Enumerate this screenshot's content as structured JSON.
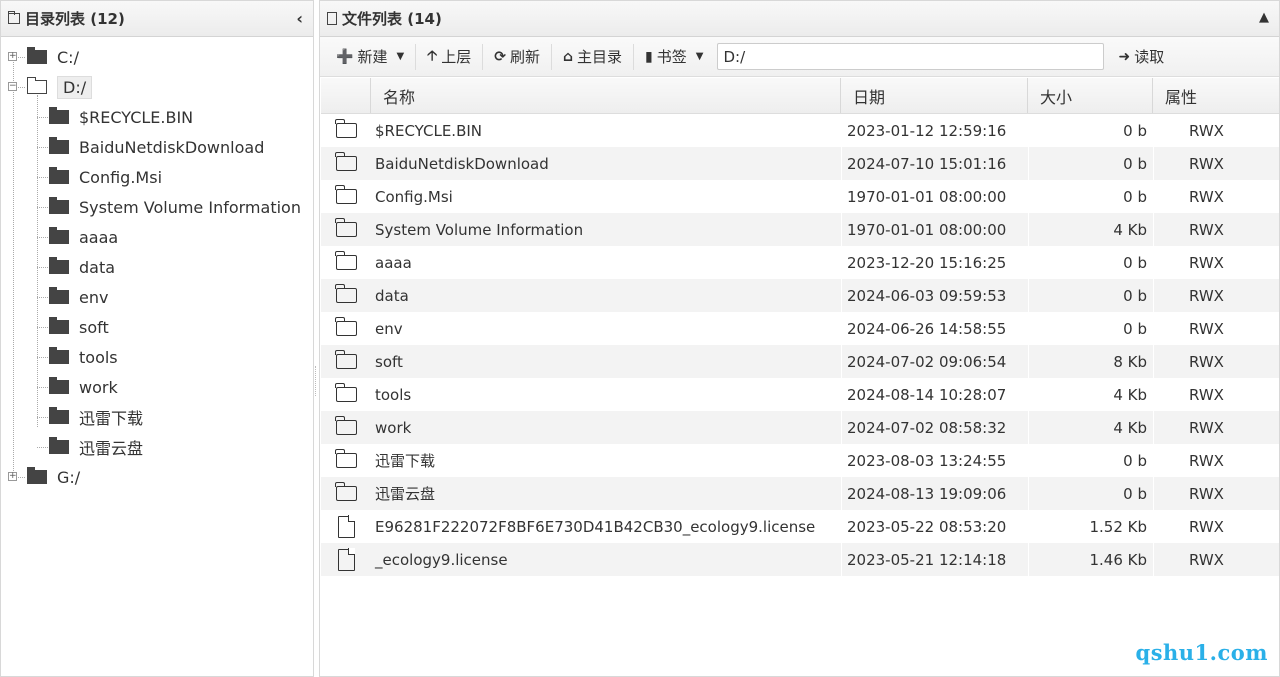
{
  "left": {
    "title": "目录列表 (12)",
    "collapse_icon": "chevron-left",
    "tree": [
      {
        "label": "C:/",
        "level": 0,
        "expanded": false
      },
      {
        "label": "D:/",
        "level": 0,
        "expanded": true,
        "selected": true
      },
      {
        "label": "$RECYCLE.BIN",
        "level": 1
      },
      {
        "label": "BaiduNetdiskDownload",
        "level": 1
      },
      {
        "label": "Config.Msi",
        "level": 1
      },
      {
        "label": "System Volume Information",
        "level": 1
      },
      {
        "label": "aaaa",
        "level": 1
      },
      {
        "label": "data",
        "level": 1
      },
      {
        "label": "env",
        "level": 1
      },
      {
        "label": "soft",
        "level": 1
      },
      {
        "label": "tools",
        "level": 1
      },
      {
        "label": "work",
        "level": 1
      },
      {
        "label": "迅雷下载",
        "level": 1
      },
      {
        "label": "迅雷云盘",
        "level": 1
      },
      {
        "label": "G:/",
        "level": 0,
        "expanded": false
      }
    ]
  },
  "right": {
    "title": "文件列表 (14)",
    "collapse_icon": "chevron-up",
    "toolbar": {
      "new_label": "新建",
      "up_label": "上层",
      "refresh_label": "刷新",
      "home_label": "主目录",
      "bookmark_label": "书签",
      "path_value": "D:/",
      "read_label": "读取"
    },
    "columns": {
      "name": "名称",
      "date": "日期",
      "size": "大小",
      "attr": "属性"
    },
    "rows": [
      {
        "type": "folder",
        "name": "$RECYCLE.BIN",
        "date": "2023-01-12 12:59:16",
        "size": "0 b",
        "attr": "RWX"
      },
      {
        "type": "folder",
        "name": "BaiduNetdiskDownload",
        "date": "2024-07-10 15:01:16",
        "size": "0 b",
        "attr": "RWX"
      },
      {
        "type": "folder",
        "name": "Config.Msi",
        "date": "1970-01-01 08:00:00",
        "size": "0 b",
        "attr": "RWX"
      },
      {
        "type": "folder",
        "name": "System Volume Information",
        "date": "1970-01-01 08:00:00",
        "size": "4 Kb",
        "attr": "RWX"
      },
      {
        "type": "folder",
        "name": "aaaa",
        "date": "2023-12-20 15:16:25",
        "size": "0 b",
        "attr": "RWX"
      },
      {
        "type": "folder",
        "name": "data",
        "date": "2024-06-03 09:59:53",
        "size": "0 b",
        "attr": "RWX"
      },
      {
        "type": "folder",
        "name": "env",
        "date": "2024-06-26 14:58:55",
        "size": "0 b",
        "attr": "RWX"
      },
      {
        "type": "folder",
        "name": "soft",
        "date": "2024-07-02 09:06:54",
        "size": "8 Kb",
        "attr": "RWX"
      },
      {
        "type": "folder",
        "name": "tools",
        "date": "2024-08-14 10:28:07",
        "size": "4 Kb",
        "attr": "RWX"
      },
      {
        "type": "folder",
        "name": "work",
        "date": "2024-07-02 08:58:32",
        "size": "4 Kb",
        "attr": "RWX"
      },
      {
        "type": "folder",
        "name": "迅雷下载",
        "date": "2023-08-03 13:24:55",
        "size": "0 b",
        "attr": "RWX"
      },
      {
        "type": "folder",
        "name": "迅雷云盘",
        "date": "2024-08-13 19:09:06",
        "size": "0 b",
        "attr": "RWX"
      },
      {
        "type": "file",
        "name": "E96281F222072F8BF6E730D41B42CB30_ecology9.license",
        "date": "2023-05-22 08:53:20",
        "size": "1.52 Kb",
        "attr": "RWX"
      },
      {
        "type": "file",
        "name": "_ecology9.license",
        "date": "2023-05-21 12:14:18",
        "size": "1.46 Kb",
        "attr": "RWX"
      }
    ]
  },
  "watermark": "qshu1.com"
}
